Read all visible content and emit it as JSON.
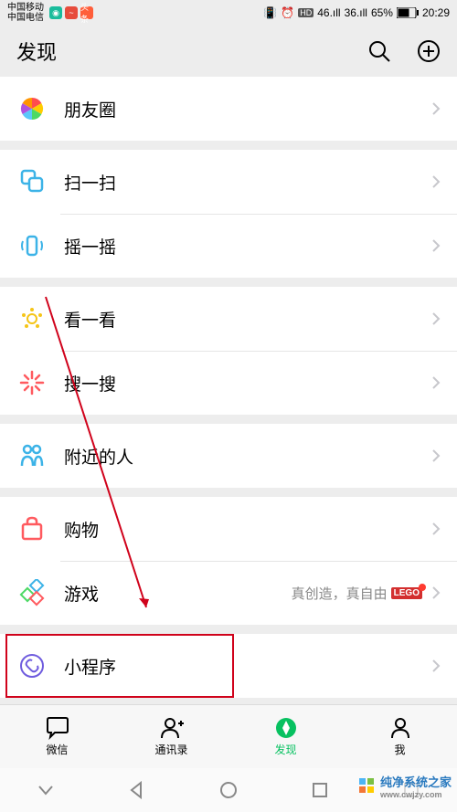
{
  "status": {
    "carrier1": "中国移动",
    "carrier2": "中国电信",
    "battery": "65%",
    "time": "20:29",
    "net1": "46",
    "net2": "36"
  },
  "header": {
    "title": "发现"
  },
  "groups": [
    {
      "items": [
        {
          "id": "moments",
          "label": "朋友圈"
        }
      ]
    },
    {
      "items": [
        {
          "id": "scan",
          "label": "扫一扫"
        },
        {
          "id": "shake",
          "label": "摇一摇"
        }
      ]
    },
    {
      "items": [
        {
          "id": "top-stories",
          "label": "看一看"
        },
        {
          "id": "search",
          "label": "搜一搜"
        }
      ]
    },
    {
      "items": [
        {
          "id": "nearby",
          "label": "附近的人"
        }
      ]
    },
    {
      "items": [
        {
          "id": "shopping",
          "label": "购物"
        },
        {
          "id": "games",
          "label": "游戏",
          "extra": "真创造，真自由",
          "lego": "LEGO"
        }
      ]
    },
    {
      "items": [
        {
          "id": "miniprogram",
          "label": "小程序",
          "highlight": true
        }
      ]
    }
  ],
  "tabs": {
    "chat": "微信",
    "contacts": "通讯录",
    "discover": "发现",
    "me": "我"
  },
  "watermark": {
    "text": "纯净系统之家",
    "url": "www.cwjzy.com"
  }
}
